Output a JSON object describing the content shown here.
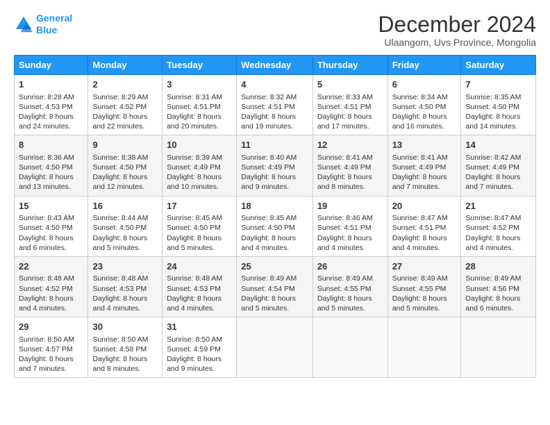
{
  "logo": {
    "line1": "General",
    "line2": "Blue"
  },
  "title": "December 2024",
  "subtitle": "Ulaangom, Uvs Province, Mongolia",
  "header_days": [
    "Sunday",
    "Monday",
    "Tuesday",
    "Wednesday",
    "Thursday",
    "Friday",
    "Saturday"
  ],
  "weeks": [
    [
      {
        "day": "1",
        "info": "Sunrise: 8:28 AM\nSunset: 4:53 PM\nDaylight: 8 hours\nand 24 minutes."
      },
      {
        "day": "2",
        "info": "Sunrise: 8:29 AM\nSunset: 4:52 PM\nDaylight: 8 hours\nand 22 minutes."
      },
      {
        "day": "3",
        "info": "Sunrise: 8:31 AM\nSunset: 4:51 PM\nDaylight: 8 hours\nand 20 minutes."
      },
      {
        "day": "4",
        "info": "Sunrise: 8:32 AM\nSunset: 4:51 PM\nDaylight: 8 hours\nand 19 minutes."
      },
      {
        "day": "5",
        "info": "Sunrise: 8:33 AM\nSunset: 4:51 PM\nDaylight: 8 hours\nand 17 minutes."
      },
      {
        "day": "6",
        "info": "Sunrise: 8:34 AM\nSunset: 4:50 PM\nDaylight: 8 hours\nand 16 minutes."
      },
      {
        "day": "7",
        "info": "Sunrise: 8:35 AM\nSunset: 4:50 PM\nDaylight: 8 hours\nand 14 minutes."
      }
    ],
    [
      {
        "day": "8",
        "info": "Sunrise: 8:36 AM\nSunset: 4:50 PM\nDaylight: 8 hours\nand 13 minutes."
      },
      {
        "day": "9",
        "info": "Sunrise: 8:38 AM\nSunset: 4:50 PM\nDaylight: 8 hours\nand 12 minutes."
      },
      {
        "day": "10",
        "info": "Sunrise: 8:39 AM\nSunset: 4:49 PM\nDaylight: 8 hours\nand 10 minutes."
      },
      {
        "day": "11",
        "info": "Sunrise: 8:40 AM\nSunset: 4:49 PM\nDaylight: 8 hours\nand 9 minutes."
      },
      {
        "day": "12",
        "info": "Sunrise: 8:41 AM\nSunset: 4:49 PM\nDaylight: 8 hours\nand 8 minutes."
      },
      {
        "day": "13",
        "info": "Sunrise: 8:41 AM\nSunset: 4:49 PM\nDaylight: 8 hours\nand 7 minutes."
      },
      {
        "day": "14",
        "info": "Sunrise: 8:42 AM\nSunset: 4:49 PM\nDaylight: 8 hours\nand 7 minutes."
      }
    ],
    [
      {
        "day": "15",
        "info": "Sunrise: 8:43 AM\nSunset: 4:50 PM\nDaylight: 8 hours\nand 6 minutes."
      },
      {
        "day": "16",
        "info": "Sunrise: 8:44 AM\nSunset: 4:50 PM\nDaylight: 8 hours\nand 5 minutes."
      },
      {
        "day": "17",
        "info": "Sunrise: 8:45 AM\nSunset: 4:50 PM\nDaylight: 8 hours\nand 5 minutes."
      },
      {
        "day": "18",
        "info": "Sunrise: 8:45 AM\nSunset: 4:50 PM\nDaylight: 8 hours\nand 4 minutes."
      },
      {
        "day": "19",
        "info": "Sunrise: 8:46 AM\nSunset: 4:51 PM\nDaylight: 8 hours\nand 4 minutes."
      },
      {
        "day": "20",
        "info": "Sunrise: 8:47 AM\nSunset: 4:51 PM\nDaylight: 8 hours\nand 4 minutes."
      },
      {
        "day": "21",
        "info": "Sunrise: 8:47 AM\nSunset: 4:52 PM\nDaylight: 8 hours\nand 4 minutes."
      }
    ],
    [
      {
        "day": "22",
        "info": "Sunrise: 8:48 AM\nSunset: 4:52 PM\nDaylight: 8 hours\nand 4 minutes."
      },
      {
        "day": "23",
        "info": "Sunrise: 8:48 AM\nSunset: 4:53 PM\nDaylight: 8 hours\nand 4 minutes."
      },
      {
        "day": "24",
        "info": "Sunrise: 8:48 AM\nSunset: 4:53 PM\nDaylight: 8 hours\nand 4 minutes."
      },
      {
        "day": "25",
        "info": "Sunrise: 8:49 AM\nSunset: 4:54 PM\nDaylight: 8 hours\nand 5 minutes."
      },
      {
        "day": "26",
        "info": "Sunrise: 8:49 AM\nSunset: 4:55 PM\nDaylight: 8 hours\nand 5 minutes."
      },
      {
        "day": "27",
        "info": "Sunrise: 8:49 AM\nSunset: 4:55 PM\nDaylight: 8 hours\nand 5 minutes."
      },
      {
        "day": "28",
        "info": "Sunrise: 8:49 AM\nSunset: 4:56 PM\nDaylight: 8 hours\nand 6 minutes."
      }
    ],
    [
      {
        "day": "29",
        "info": "Sunrise: 8:50 AM\nSunset: 4:57 PM\nDaylight: 8 hours\nand 7 minutes."
      },
      {
        "day": "30",
        "info": "Sunrise: 8:50 AM\nSunset: 4:58 PM\nDaylight: 8 hours\nand 8 minutes."
      },
      {
        "day": "31",
        "info": "Sunrise: 8:50 AM\nSunset: 4:59 PM\nDaylight: 8 hours\nand 9 minutes."
      },
      {
        "day": "",
        "info": ""
      },
      {
        "day": "",
        "info": ""
      },
      {
        "day": "",
        "info": ""
      },
      {
        "day": "",
        "info": ""
      }
    ]
  ]
}
